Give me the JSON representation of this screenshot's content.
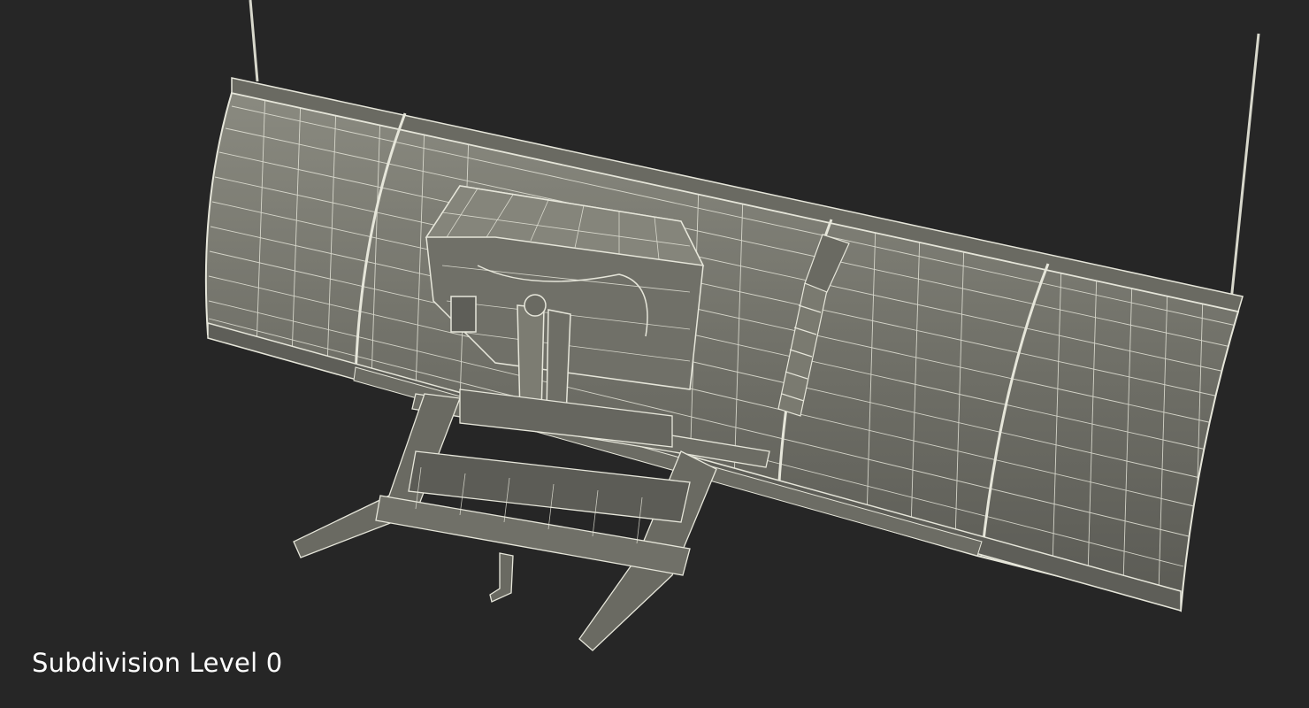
{
  "caption": "Subdivision Level 0",
  "colors": {
    "background": "#262626",
    "surface": "#76766c",
    "surface_shadow": "#55554f",
    "wire": "#e6e6da",
    "caption": "#ffffff"
  }
}
